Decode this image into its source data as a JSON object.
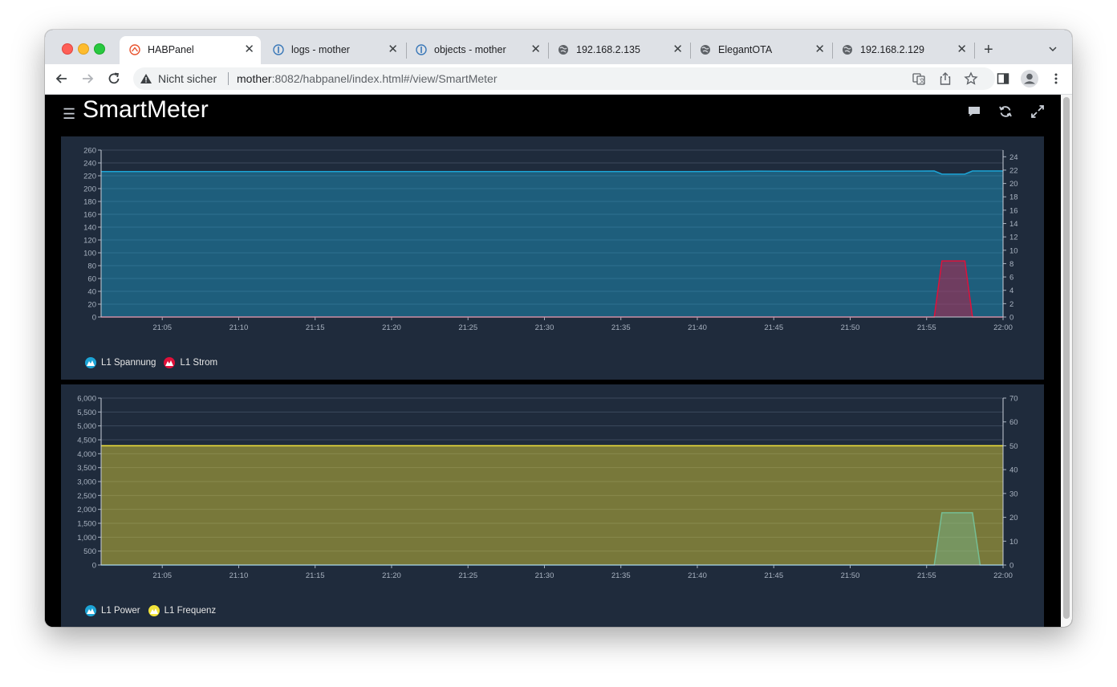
{
  "browser": {
    "tabs": [
      {
        "title": "HABPanel",
        "icon": "habpanel-icon",
        "active": true
      },
      {
        "title": "logs - mother",
        "icon": "openhab-icon",
        "active": false
      },
      {
        "title": "objects - mother",
        "icon": "openhab-icon",
        "active": false
      },
      {
        "title": "192.168.2.135",
        "icon": "globe-icon",
        "active": false
      },
      {
        "title": "ElegantOTA",
        "icon": "globe-icon",
        "active": false
      },
      {
        "title": "192.168.2.129",
        "icon": "globe-icon",
        "active": false
      }
    ],
    "security_label": "Nicht sicher",
    "url_host": "mother",
    "url_rest": ":8082/habpanel/index.html#/view/SmartMeter"
  },
  "dashboard": {
    "title": "SmartMeter"
  },
  "chart_data": [
    {
      "type": "area",
      "x_ticks": [
        "21:05",
        "21:10",
        "21:15",
        "21:20",
        "21:25",
        "21:30",
        "21:35",
        "21:40",
        "21:45",
        "21:50",
        "21:55",
        "22:00"
      ],
      "x": [
        "21:01",
        "21:40",
        "21:44",
        "21:48",
        "21:55:30",
        "21:56",
        "21:57:30",
        "21:58",
        "22:00"
      ],
      "ylim": [
        0,
        260
      ],
      "y_ticks": [
        0,
        20,
        40,
        60,
        80,
        100,
        120,
        140,
        160,
        180,
        200,
        220,
        240,
        260
      ],
      "y2lim": [
        0,
        25
      ],
      "y2_ticks": [
        0,
        2,
        4,
        6,
        8,
        10,
        12,
        14,
        16,
        18,
        20,
        22,
        24
      ],
      "grid": true,
      "legend_position": "bottom-left",
      "series": [
        {
          "name": "L1 Spannung",
          "axis": "left",
          "color": "#1ca4d6",
          "values": [
            226.5,
            226.5,
            227.2,
            226.8,
            227.5,
            222.5,
            222.5,
            227.5,
            227.5
          ]
        },
        {
          "name": "L1 Strom",
          "axis": "right",
          "color": "#e0103a",
          "values": [
            0,
            0,
            0,
            0,
            0,
            8.4,
            8.4,
            0,
            0
          ]
        }
      ]
    },
    {
      "type": "area",
      "x_ticks": [
        "21:05",
        "21:10",
        "21:15",
        "21:20",
        "21:25",
        "21:30",
        "21:35",
        "21:40",
        "21:45",
        "21:50",
        "21:55",
        "22:00"
      ],
      "x": [
        "21:01",
        "21:55:30",
        "21:56",
        "21:58",
        "21:58:30",
        "22:00"
      ],
      "ylim": [
        0,
        6000
      ],
      "y_ticks": [
        "0",
        "500",
        "1,000",
        "1,500",
        "2,000",
        "2,500",
        "3,000",
        "3,500",
        "4,000",
        "4,500",
        "5,000",
        "5,500",
        "6,000"
      ],
      "y2lim": [
        0,
        70
      ],
      "y2_ticks": [
        0,
        10,
        20,
        30,
        40,
        50,
        60,
        70
      ],
      "grid": true,
      "legend_position": "bottom-left",
      "series": [
        {
          "name": "L1 Power",
          "axis": "left",
          "color": "#1ca4d6",
          "values": [
            0,
            0,
            1880,
            1880,
            0,
            0
          ]
        },
        {
          "name": "L1 Frequenz",
          "axis": "right",
          "color": "#f2e33a",
          "values": [
            50,
            50,
            50,
            50,
            50,
            50
          ]
        }
      ]
    }
  ]
}
